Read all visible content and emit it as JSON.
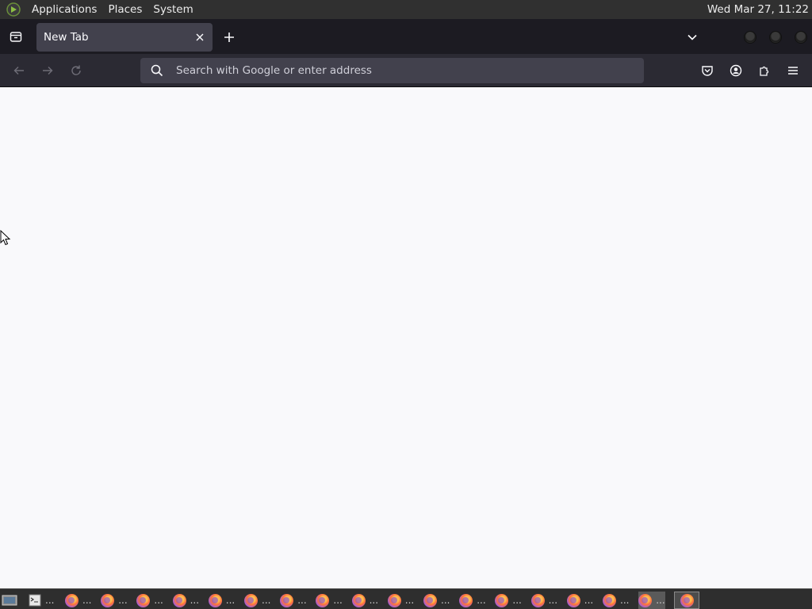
{
  "top_panel": {
    "menus": [
      "Applications",
      "Places",
      "System"
    ],
    "clock": "Wed Mar 27, 11:22"
  },
  "browser": {
    "tab": {
      "title": "New Tab"
    },
    "urlbar": {
      "placeholder": "Search with Google or enter address",
      "value": ""
    }
  },
  "taskbar": {
    "firefox_window_count": 18,
    "ellipsis": "..."
  },
  "colors": {
    "panel": "#303030",
    "tabstrip": "#1c1b22",
    "toolbar": "#2b2a33",
    "urlbar": "#42414d",
    "content": "#f9f9fb"
  }
}
